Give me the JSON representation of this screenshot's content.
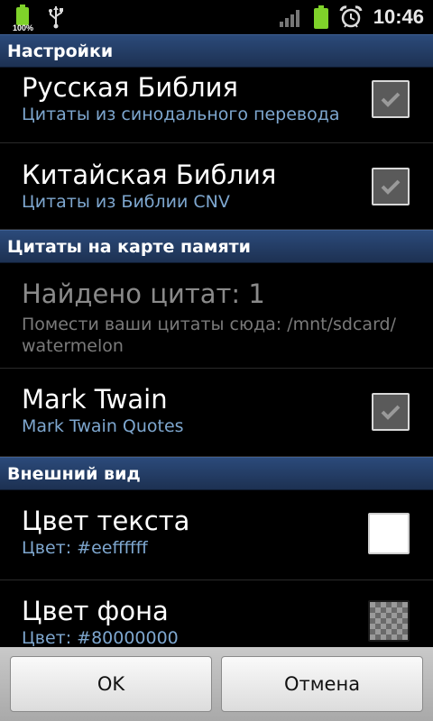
{
  "status_bar": {
    "battery_small_label": "100%",
    "time": "10:46",
    "icons": [
      "battery-icon",
      "usb-icon",
      "signal-icon",
      "battery-icon",
      "alarm-icon"
    ]
  },
  "sections": [
    {
      "header": "Настройки",
      "items": [
        {
          "title": "Русская Библия",
          "summary": "Цитаты из синодального перевода",
          "widget": "checkbox",
          "checked": true
        },
        {
          "title": "Китайская Библия",
          "summary": "Цитаты из Библии CNV",
          "widget": "checkbox",
          "checked": true
        }
      ]
    },
    {
      "header": "Цитаты на карте памяти",
      "items": [
        {
          "title": "Найдено цитат: 1",
          "summary": "Помести ваши цитаты сюда: /mnt/sdcard/\nwatermelon",
          "widget": "none",
          "disabled": true
        },
        {
          "title": "Mark Twain",
          "summary": "Mark Twain Quotes",
          "widget": "checkbox",
          "checked": true
        }
      ]
    },
    {
      "header": "Внешний вид",
      "items": [
        {
          "title": "Цвет текста",
          "summary": "Цвет: #eeffffff",
          "widget": "color",
          "color": "#eeffffff"
        },
        {
          "title": "Цвет фона",
          "summary": "Цвет: #80000000",
          "widget": "color",
          "color": "#80000000"
        }
      ]
    }
  ],
  "buttons": {
    "ok": "OK",
    "cancel": "Отмена"
  },
  "colors": {
    "header_bg": "#233b63",
    "summary_text": "#7ea7cf",
    "battery_green": "#7fd22a"
  }
}
